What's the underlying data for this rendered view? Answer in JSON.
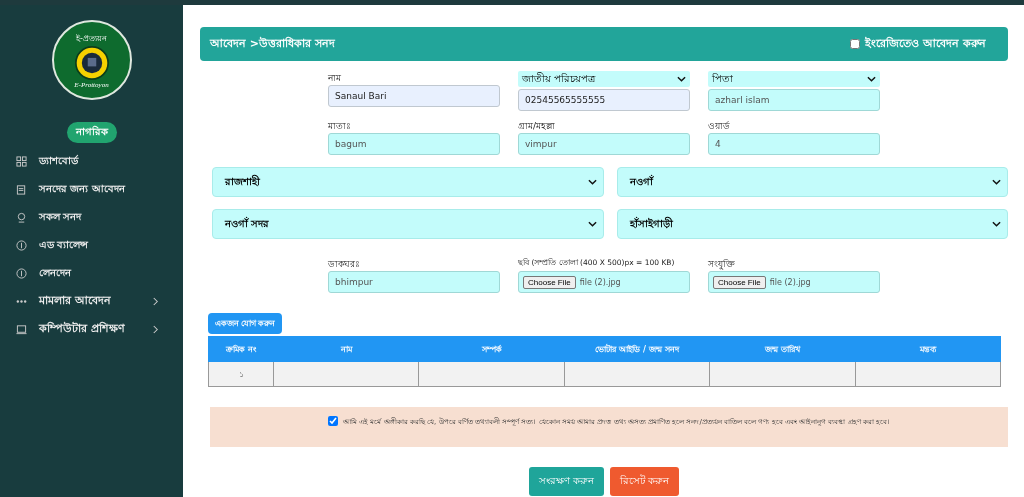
{
  "sidebar": {
    "logo": {
      "top_text": "ই-প্রত্যয়ন",
      "bottom_text": "E-Prottoyon"
    },
    "role_badge": "নাগরিক",
    "items": [
      {
        "label": "ড্যাশবোর্ড",
        "expandable": false
      },
      {
        "label": "সনদের জন্য আবেদন",
        "expandable": false
      },
      {
        "label": "সকল সনদ",
        "expandable": false
      },
      {
        "label": "এড ব্যালেন্স",
        "expandable": false
      },
      {
        "label": "লেনদেন",
        "expandable": false
      },
      {
        "label": "মামলার আবেদন",
        "expandable": true
      },
      {
        "label": "কম্পিউটার প্রশিক্ষণ",
        "expandable": true
      }
    ]
  },
  "header": {
    "title": "আবেদন >উত্তরাধিকার সনদ",
    "english_option": {
      "label": "ইংরেজিতেও আবেদন করুন",
      "checked": false
    }
  },
  "fields": [
    {
      "kind": "text",
      "label": "নাম",
      "value": "Sanaul Bari",
      "autofilled": true
    },
    {
      "kind": "select",
      "label": "জাতীয় পরিচয়পত্র",
      "value": "02545565555555",
      "autofilled": true
    },
    {
      "kind": "select",
      "label": "পিতা",
      "value": "azharl islam",
      "autofilled": false
    },
    {
      "kind": "text",
      "label": "মাতাঃ",
      "value": "bagum",
      "autofilled": false
    },
    {
      "kind": "text",
      "label": "গ্রাম/মহল্লা",
      "value": "vimpur",
      "autofilled": false
    },
    {
      "kind": "text",
      "label": "ওয়ার্ড",
      "value": "4",
      "autofilled": false
    }
  ],
  "location_selects": [
    "রাজশাহী",
    "নওগাঁ",
    "নওগাঁ সদর",
    "হাঁসাইগাড়ী"
  ],
  "lower_fields": [
    {
      "kind": "text",
      "label": "ডাকঘরঃ",
      "value": "bhimpur"
    },
    {
      "kind": "file",
      "label": "ছবি (সম্প্রতি তোলা (400 X 500)px = 100 KB)",
      "button": "Choose File",
      "value": "file (2).jpg"
    },
    {
      "kind": "file",
      "label": "সংযুক্তি",
      "button": "Choose File",
      "value": "file (2).jpg"
    }
  ],
  "add_person_button": "একজন যোগ করুন",
  "table": {
    "columns": [
      "ক্রমিক নং",
      "নাম",
      "সম্পর্ক",
      "ভোটার আইডি / জন্ম সনদ",
      "জন্ম তারিখ",
      "মন্তব্য"
    ],
    "rows": [
      [
        "১",
        "",
        "",
        "",
        "",
        ""
      ]
    ]
  },
  "declaration": {
    "text": "আমি এই মর্মে অঙ্গীকার করছি যে, উপরে বর্ণিত তথ্যাবলী সম্পূর্ণ সত্য। যেকোন সময় আমার প্রদত্ত তথ্য অসত্য প্রমাণিত হলে সনদ/প্রত্যয়ন বাতিল বলে গণ্য হবে এবং আইনানুগ ব্যবস্থা গ্রহণ করা হবে।",
    "checked": true
  },
  "buttons": [
    {
      "label": "সংরক্ষণ করুন",
      "kind": "save"
    },
    {
      "label": "রিসেট করুন",
      "kind": "reset"
    }
  ]
}
